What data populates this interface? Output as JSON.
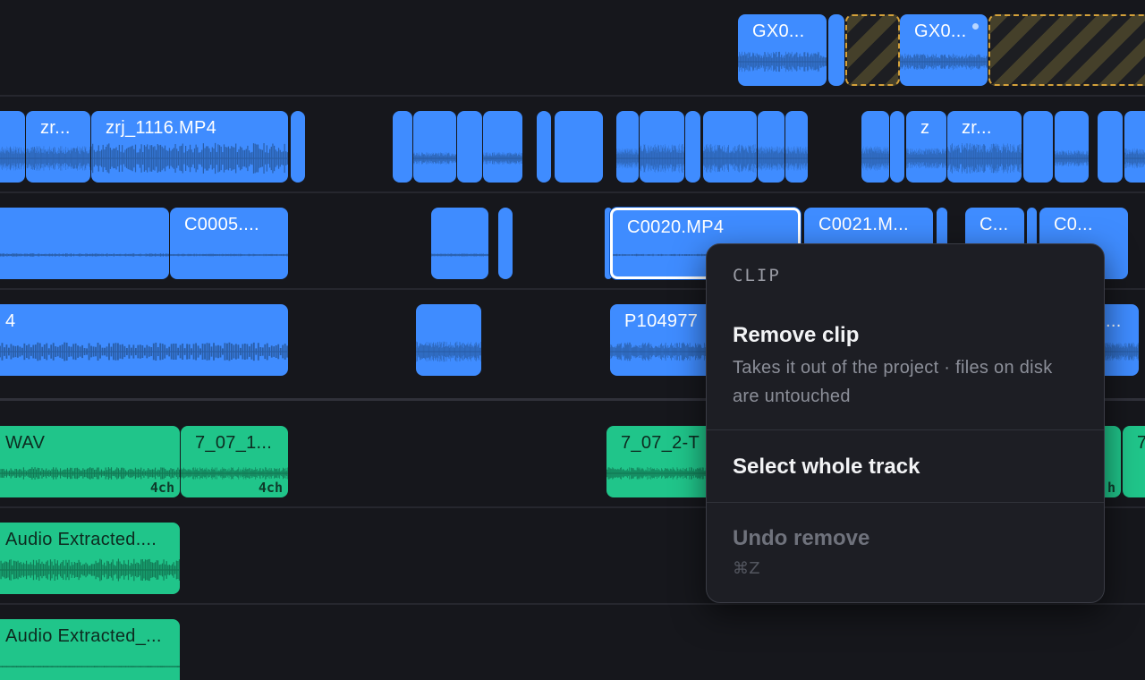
{
  "timeline": {
    "clips": {
      "v4_a": "GX0...",
      "v4_b": "GX0...",
      "v3_a": "zr...",
      "v3_b": "zrj_1116.MP4",
      "v3_c": "z",
      "v3_d": "zr...",
      "v2_a": "C0005....",
      "v2_b": "C0020.MP4",
      "v2_c": "C0021.M...",
      "v2_d": "C...",
      "v2_e": "C0...",
      "v1_a": "4",
      "v1_b": "P104977",
      "v1_c": "...",
      "a1_a": "WAV",
      "a1_b": "7_07_1...",
      "a1_c": "7_07_2-T",
      "a1_d": "7",
      "a2_a": "Audio Extracted....",
      "a3_a": "Audio Extracted_..."
    },
    "badge_4ch": "4ch",
    "badge_h": "h"
  },
  "context_menu": {
    "header": "CLIP",
    "items": [
      {
        "title": "Remove clip",
        "subtitle": "Takes it out of the project · files on disk are untouched"
      },
      {
        "title": "Select whole track",
        "subtitle": ""
      },
      {
        "title": "Undo remove",
        "subtitle": "⌘Z"
      }
    ]
  },
  "colors": {
    "background": "#16171c",
    "video_clip": "#3f8cff",
    "audio_clip": "#20c58a",
    "gap_stripe": "#d4a13a",
    "menu_bg": "#1d1e24"
  }
}
